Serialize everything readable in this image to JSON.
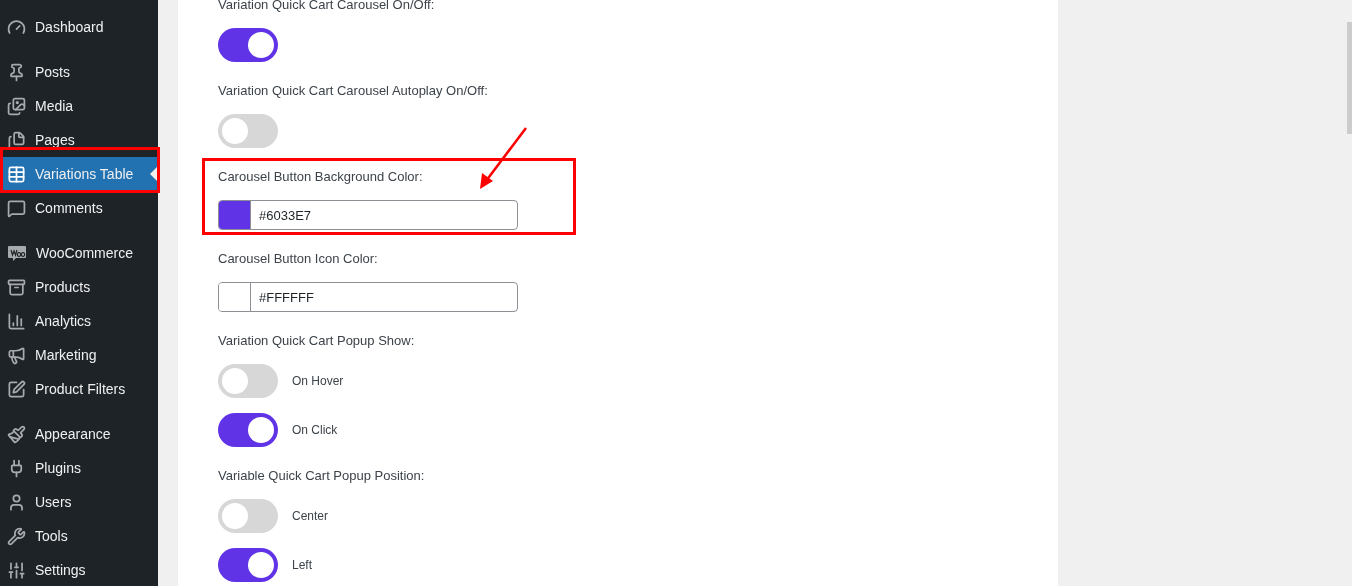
{
  "sidebar": {
    "groups": [
      {
        "items": [
          {
            "label": "Dashboard",
            "selected": false,
            "annotated": false
          }
        ]
      },
      {
        "items": [
          {
            "label": "Posts",
            "selected": false,
            "annotated": false
          },
          {
            "label": "Media",
            "selected": false,
            "annotated": false
          },
          {
            "label": "Pages",
            "selected": false,
            "annotated": false
          },
          {
            "label": "Variations Table",
            "selected": true,
            "annotated": true
          },
          {
            "label": "Comments",
            "selected": false,
            "annotated": false
          }
        ]
      },
      {
        "items": [
          {
            "label": "WooCommerce",
            "selected": false,
            "annotated": false
          },
          {
            "label": "Products",
            "selected": false,
            "annotated": false
          },
          {
            "label": "Analytics",
            "selected": false,
            "annotated": false
          },
          {
            "label": "Marketing",
            "selected": false,
            "annotated": false
          },
          {
            "label": "Product Filters",
            "selected": false,
            "annotated": false
          }
        ]
      },
      {
        "items": [
          {
            "label": "Appearance",
            "selected": false,
            "annotated": false
          },
          {
            "label": "Plugins",
            "selected": false,
            "annotated": false
          },
          {
            "label": "Users",
            "selected": false,
            "annotated": false
          },
          {
            "label": "Tools",
            "selected": false,
            "annotated": false
          },
          {
            "label": "Settings",
            "selected": false,
            "annotated": false
          }
        ]
      }
    ]
  },
  "settings": [
    {
      "kind": "toggle",
      "label": "Variation Quick Cart Carousel On/Off:",
      "on": true,
      "annotated": false
    },
    {
      "kind": "toggle",
      "label": "Variation Quick Cart Carousel Autoplay On/Off:",
      "on": false,
      "annotated": false
    },
    {
      "kind": "color",
      "label": "Carousel Button Background Color:",
      "value": "#6033E7",
      "color": "#6033e7",
      "annotated": true
    },
    {
      "kind": "color",
      "label": "Carousel Button Icon Color:",
      "value": "#FFFFFF",
      "color": "#ffffff",
      "annotated": false
    },
    {
      "kind": "options",
      "label": "Variation Quick Cart Popup Show:",
      "annotated": false,
      "options": [
        {
          "label": "On Hover",
          "on": false
        },
        {
          "label": "On Click",
          "on": true
        }
      ]
    },
    {
      "kind": "options",
      "label": "Variable Quick Cart Popup Position:",
      "annotated": false,
      "options": [
        {
          "label": "Center",
          "on": false
        },
        {
          "label": "Left",
          "on": true
        }
      ]
    }
  ]
}
